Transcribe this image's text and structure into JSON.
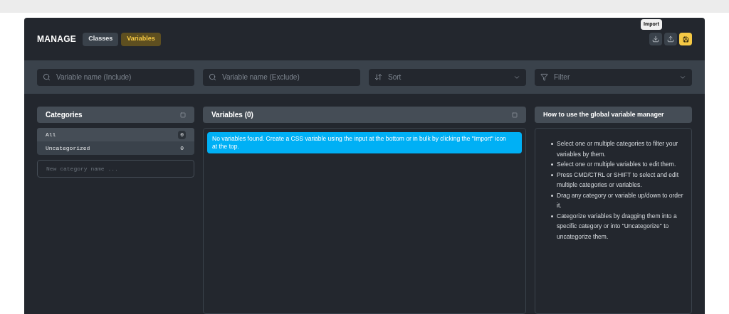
{
  "header": {
    "title": "MANAGE",
    "tabs": [
      {
        "label": "Classes",
        "selected": false
      },
      {
        "label": "Variables",
        "selected": true
      }
    ],
    "tooltip": "Import"
  },
  "filters": {
    "include": {
      "placeholder": "Variable name (Include)"
    },
    "exclude": {
      "placeholder": "Variable name (Exclude)"
    },
    "sort": {
      "placeholder": "Sort"
    },
    "filter": {
      "placeholder": "Filter"
    }
  },
  "categories": {
    "title": "Categories",
    "items": [
      {
        "name": "All",
        "count": "0",
        "selected": true
      },
      {
        "name": "Uncategorized",
        "count": "0",
        "selected": false
      }
    ],
    "new_category": {
      "placeholder": "New category name ..."
    }
  },
  "variables": {
    "title": "Variables (0)",
    "notice": "No variables found. Create a CSS variable using the input at the bottom or in bulk by clicking the \"Import\" icon at the top."
  },
  "help": {
    "title": "How to use the global variable manager",
    "items": [
      "Select one or multiple categories to filter your variables by them.",
      "Select one or multiple variables to edit them.",
      "Press CMD/CTRL or SHIFT to select and edit multiple categories or variables.",
      "Drag any category or variable up/down to order it.",
      "Categorize variables by dragging them into a specific category or into \"Uncategorize\" to uncategorize them."
    ]
  }
}
